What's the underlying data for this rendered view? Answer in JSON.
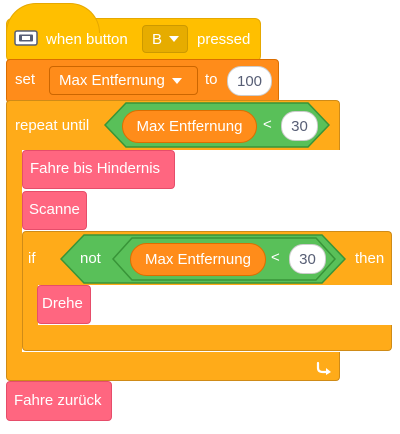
{
  "hat": {
    "prefix": "when button",
    "button_value": "B",
    "suffix": "pressed",
    "icon": "brick-icon"
  },
  "set_block": {
    "label": "set",
    "variable": "Max Entfernung",
    "to_label": "to",
    "value": "100"
  },
  "repeat_block": {
    "label": "repeat until",
    "condition_var": "Max Entfernung",
    "operator": "<",
    "value": "30",
    "loop_icon": "loop-arrow-icon"
  },
  "inner_blocks": {
    "drive": "Fahre bis Hindernis",
    "scan": "Scanne"
  },
  "if_block": {
    "label": "if",
    "not_label": "not",
    "condition_var": "Max Entfernung",
    "operator": "<",
    "value": "30",
    "then_label": "then",
    "inner": "Drehe"
  },
  "final_block": {
    "label": "Fahre zurück"
  },
  "colors": {
    "event": "#ffbf00",
    "variable": "#ff8c1a",
    "control": "#ffab19",
    "operator": "#59c059",
    "custom": "#ff6680"
  }
}
